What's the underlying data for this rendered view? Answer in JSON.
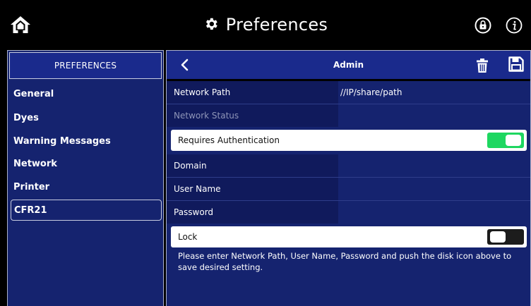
{
  "topbar": {
    "title": "Preferences",
    "home_icon": "home-icon",
    "settings_icon": "gear-icon",
    "lock_icon": "lock-icon",
    "info_icon": "info-icon"
  },
  "sidebar": {
    "header": "PREFERENCES",
    "items": [
      {
        "label": "General"
      },
      {
        "label": "Dyes"
      },
      {
        "label": "Warning Messages"
      },
      {
        "label": "Network"
      },
      {
        "label": "Printer"
      },
      {
        "label": "CFR21",
        "selected": true
      }
    ]
  },
  "panel": {
    "title": "Admin",
    "back_icon": "chevron-left-icon",
    "delete_icon": "trash-icon",
    "save_icon": "floppy-disk-icon",
    "fields": {
      "network_path": {
        "label": "Network Path",
        "value": "//IP/share/path"
      },
      "network_status": {
        "label": "Network Status",
        "value": ""
      },
      "requires_auth": {
        "label": "Requires Authentication",
        "on": true
      },
      "domain": {
        "label": "Domain",
        "value": ""
      },
      "user_name": {
        "label": "User Name",
        "value": ""
      },
      "password": {
        "label": "Password",
        "value": ""
      },
      "lock": {
        "label": "Lock",
        "on": false
      }
    },
    "hint": "Please enter Network Path, User Name, Password and push the disk icon above to save desired setting."
  },
  "colors": {
    "background": "#000000",
    "panel": "#15236f",
    "label_column": "#101a5c",
    "header": "#1a2a8c",
    "toggle_on": "#1ed760",
    "toggle_off": "#1c1c1c"
  }
}
